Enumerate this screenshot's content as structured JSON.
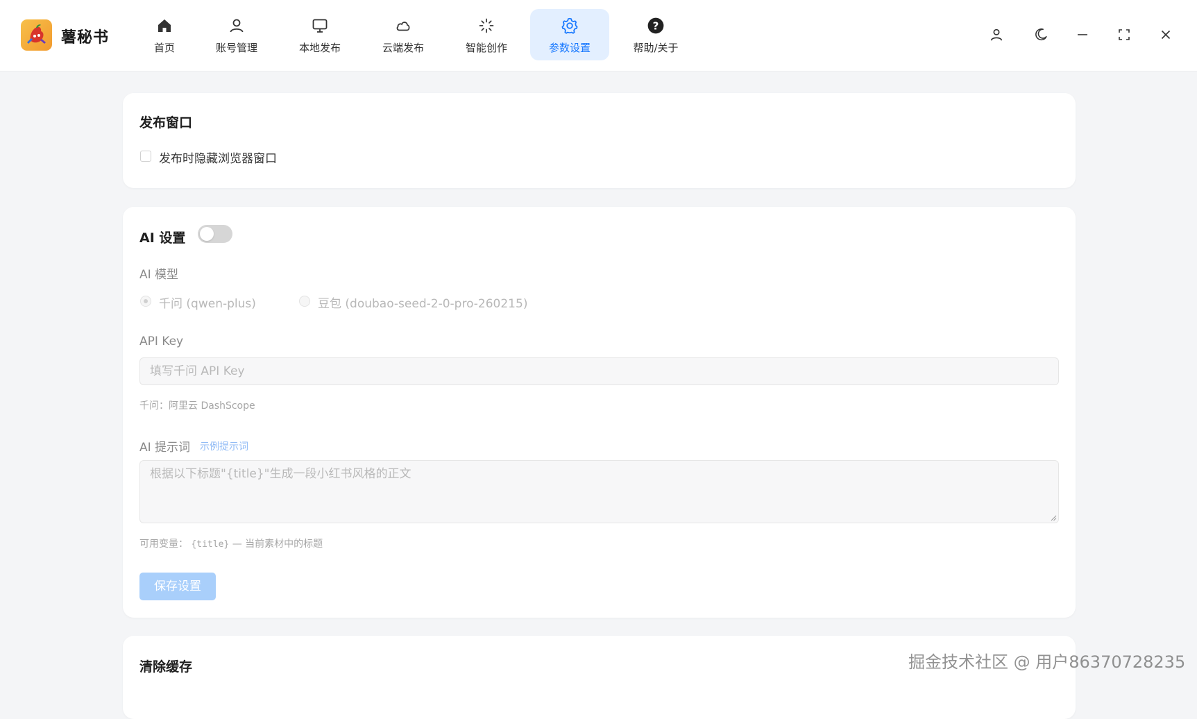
{
  "app": {
    "name": "薯秘书"
  },
  "nav": {
    "items": [
      {
        "label": "首页",
        "icon": "home-icon"
      },
      {
        "label": "账号管理",
        "icon": "user-icon"
      },
      {
        "label": "本地发布",
        "icon": "monitor-icon"
      },
      {
        "label": "云端发布",
        "icon": "cloud-icon"
      },
      {
        "label": "智能创作",
        "icon": "sparkle-icon"
      },
      {
        "label": "参数设置",
        "icon": "gear-icon",
        "active": true
      },
      {
        "label": "帮助/关于",
        "icon": "help-icon"
      }
    ]
  },
  "window_controls": [
    "user-icon",
    "moon-icon",
    "minimize-icon",
    "maximize-icon",
    "close-icon"
  ],
  "publish_window": {
    "title": "发布窗口",
    "hide_browser_label": "发布时隐藏浏览器窗口",
    "hide_browser_checked": false
  },
  "ai_settings": {
    "title": "AI 设置",
    "enabled": false,
    "model_label": "AI 模型",
    "models": [
      {
        "label": "千问 (qwen-plus)",
        "selected": true
      },
      {
        "label": "豆包 (doubao-seed-2-0-pro-260215)",
        "selected": false
      }
    ],
    "api_key_label": "API Key",
    "api_key_placeholder": "填写千问 API Key",
    "api_key_hint": "千问：阿里云 DashScope",
    "prompt_label": "AI 提示词",
    "example_prompt_link": "示例提示词",
    "prompt_placeholder": "根据以下标题\"{title}\"生成一段小红书风格的正文",
    "variables_hint_prefix": "可用变量：",
    "variables_hint_code": "{title}",
    "variables_hint_suffix": " — 当前素材中的标题",
    "save_button": "保存设置"
  },
  "clear_cache": {
    "title": "清除缓存"
  },
  "watermark": "掘金技术社区 @ 用户86370728235",
  "colors": {
    "accent": "#1677ff",
    "active_nav_bg": "#e3efff",
    "page_bg": "#f4f5f7",
    "save_button_disabled": "#a9cffb"
  }
}
